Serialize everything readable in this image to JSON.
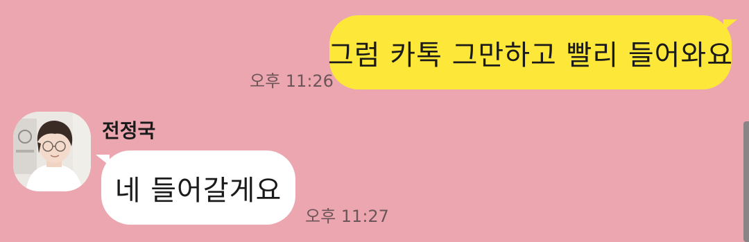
{
  "colors": {
    "background": "#eca6b0",
    "outgoing_bubble": "#fde839",
    "incoming_bubble": "#ffffff",
    "timestamp": "#6c5559"
  },
  "messages": {
    "outgoing": {
      "text": "그럼 카톡 그만하고 빨리 들어와요",
      "time": "오후 11:26"
    },
    "incoming": {
      "sender": "전정국",
      "avatar_icon": "profile-photo",
      "text": "네 들어갈게요",
      "time": "오후 11:27"
    }
  }
}
